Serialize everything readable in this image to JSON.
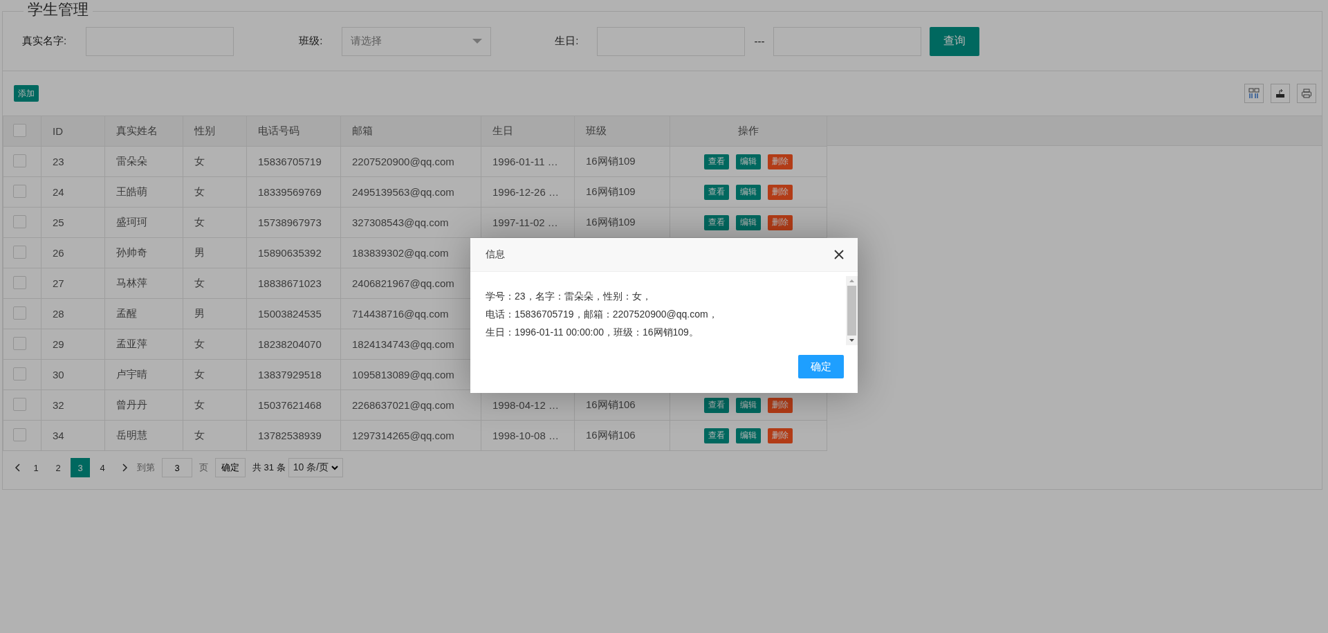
{
  "title": "学生管理",
  "filters": [
    {
      "kind": "input",
      "label": "真实名字:"
    },
    {
      "kind": "select",
      "label": "班级:",
      "placeholder": "请选择"
    },
    {
      "kind": "daterange",
      "label": "生日:",
      "separator": "---"
    }
  ],
  "search_button": "查询",
  "add_button": "添加",
  "table": {
    "header_checked": false,
    "columns": [
      "ID",
      "真实姓名",
      "性别",
      "电话号码",
      "邮箱",
      "生日",
      "班级",
      "操作"
    ],
    "rows": [
      {
        "checked": false,
        "cells": [
          "23",
          "雷朵朵",
          "女",
          "15836705719",
          "2207520900@qq.com",
          "1996-01-11 …",
          "16网销109"
        ],
        "actions": [
          "查看",
          "编辑",
          "删除"
        ]
      },
      {
        "checked": false,
        "cells": [
          "24",
          "王皓萌",
          "女",
          "18339569769",
          "2495139563@qq.com",
          "1996-12-26 …",
          "16网销109"
        ],
        "actions": [
          "查看",
          "编辑",
          "删除"
        ]
      },
      {
        "checked": false,
        "cells": [
          "25",
          "盛珂珂",
          "女",
          "15738967973",
          "327308543@qq.com",
          "1997-11-02 …",
          "16网销109"
        ],
        "actions": [
          "查看",
          "编辑",
          "删除"
        ]
      },
      {
        "checked": false,
        "cells": [
          "26",
          "孙帅奇",
          "男",
          "15890635392",
          "183839302@qq.com"
        ]
      },
      {
        "checked": false,
        "cells": [
          "27",
          "马林萍",
          "女",
          "18838671023",
          "2406821967@qq.com"
        ]
      },
      {
        "checked": false,
        "cells": [
          "28",
          "孟醒",
          "男",
          "15003824535",
          "714438716@qq.com"
        ]
      },
      {
        "checked": false,
        "cells": [
          "29",
          "孟亚萍",
          "女",
          "18238204070",
          "1824134743@qq.com"
        ]
      },
      {
        "checked": false,
        "cells": [
          "30",
          "卢宇晴",
          "女",
          "13837929518",
          "1095813089@qq.com"
        ]
      },
      {
        "checked": false,
        "cells": [
          "32",
          "曾丹丹",
          "女",
          "15037621468",
          "2268637021@qq.com",
          "1998-04-12 …",
          "16网销106"
        ],
        "actions": [
          "查看",
          "编辑",
          "删除"
        ]
      },
      {
        "checked": false,
        "cells": [
          "34",
          "岳明慧",
          "女",
          "13782538939",
          "1297314265@qq.com",
          "1998-10-08 …",
          "16网销106"
        ],
        "actions": [
          "查看",
          "编辑",
          "删除"
        ]
      }
    ]
  },
  "pagination": {
    "pages": [
      {
        "label": "1",
        "selected": false
      },
      {
        "label": "2",
        "selected": false
      },
      {
        "label": "3",
        "selected": true
      },
      {
        "label": "4",
        "selected": false
      }
    ],
    "goto_label": "到第",
    "goto_value": "3",
    "page_label": "页",
    "confirm": "确定",
    "total": "共 31 条",
    "page_size": "10 条/页"
  },
  "dialog": {
    "title": "信息",
    "lines": [
      "学号：23，名字：雷朵朵，性别：女，",
      "电话：15836705719，邮箱：2207520900@qq.com，",
      "生日：1996-01-11 00:00:00，班级：16网销109。"
    ],
    "ok": "确定"
  }
}
